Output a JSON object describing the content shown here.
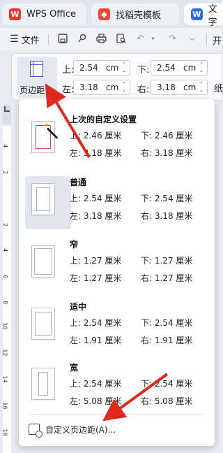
{
  "tabs": [
    {
      "label": "WPS Office",
      "icon": "wps-logo-icon"
    },
    {
      "label": "找稻壳模板",
      "icon": "docer-logo-icon"
    },
    {
      "label": "文字",
      "icon": "word-doc-icon",
      "icon_glyph": "W"
    }
  ],
  "toolbar": {
    "file_label": "文件",
    "right_label": "开"
  },
  "ribbon": {
    "margin_button_label": "页边距",
    "top_label": "上:",
    "bottom_label": "下:",
    "left_label": "左:",
    "right_label": "右:",
    "top_value": "2.54",
    "bottom_value": "2.54",
    "left_value": "3.18",
    "right_value": "3.18",
    "unit": "cm",
    "more_label": "纸"
  },
  "ruler_numbers": [
    "4",
    "2",
    "2",
    "4",
    "6",
    "8",
    "10",
    "12",
    "14",
    "16",
    "18"
  ],
  "presets": [
    {
      "title": "上次的自定义设置",
      "top": "上: 2.46 厘米",
      "bottom": "下: 2.46 厘米",
      "left": "左: 3.18 厘米",
      "right": "右: 3.18 厘米"
    },
    {
      "title": "普通",
      "top": "上: 2.54 厘米",
      "bottom": "下: 2.54 厘米",
      "left": "左: 3.18 厘米",
      "right": "右: 3.18 厘米"
    },
    {
      "title": "窄",
      "top": "上: 1.27 厘米",
      "bottom": "下: 1.27 厘米",
      "left": "左: 1.27 厘米",
      "right": "右: 1.27 厘米"
    },
    {
      "title": "适中",
      "top": "上: 2.54 厘米",
      "bottom": "下: 2.54 厘米",
      "left": "左: 1.91 厘米",
      "right": "右: 1.91 厘米"
    },
    {
      "title": "宽",
      "top": "上: 2.54 厘米",
      "bottom": "下: 2.54 厘米",
      "left": "左: 5.08 厘米",
      "right": "右: 5.08 厘米"
    }
  ],
  "custom_margin_label": "自定义页边距(A)...",
  "colors": {
    "accent": "#3a63c6",
    "annotation_arrow": "#e0281e",
    "wps_red": "#e8382e",
    "word_blue": "#2b6de5"
  }
}
